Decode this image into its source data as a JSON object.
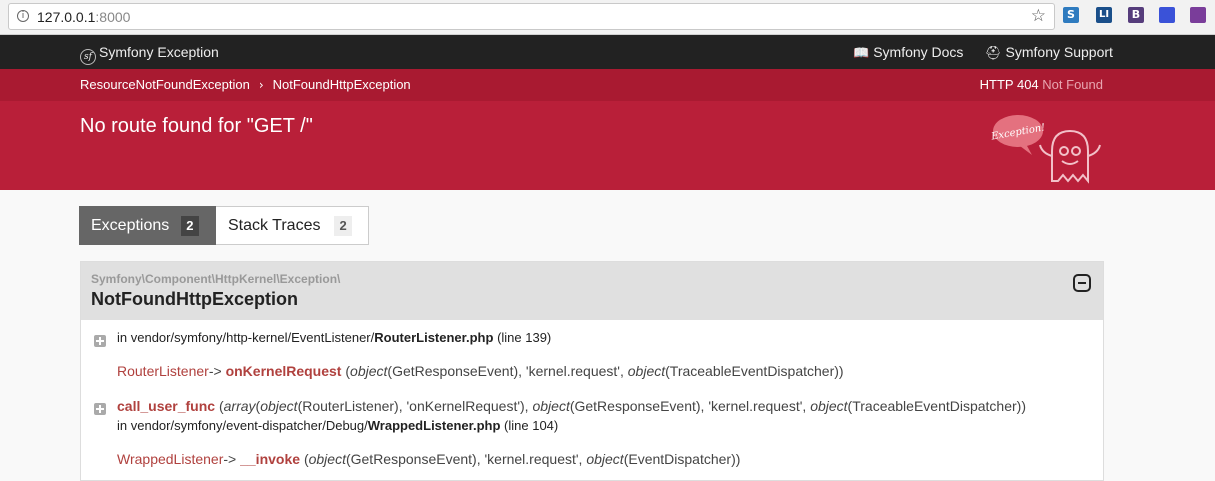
{
  "browser": {
    "url_host": "127.0.0.1",
    "url_port": ":8000",
    "info_glyph": "i",
    "star_glyph": "☆",
    "extensions": [
      {
        "name": "stackedit-extension-icon",
        "glyph": "S",
        "color": "#2f7bbf"
      },
      {
        "name": "linkedin-extension-icon",
        "glyph": "LI",
        "color": "#1a4f8a"
      },
      {
        "name": "bootstrap-extension-icon",
        "glyph": "B",
        "color": "#563d7c"
      },
      {
        "name": "window-extension-icon",
        "glyph": "",
        "color": "#3a52d8"
      },
      {
        "name": "bookmark-extension-icon",
        "glyph": "",
        "color": "#7a3d9a"
      }
    ]
  },
  "topbar": {
    "brand": "Symfony Exception",
    "docs": "Symfony Docs",
    "support": "Symfony Support"
  },
  "breadcrumb": {
    "items": [
      "ResourceNotFoundException",
      "NotFoundHttpException"
    ],
    "separator": "›"
  },
  "status": {
    "code": "HTTP 404",
    "text": "Not Found"
  },
  "title": "No route found for \"GET /\"",
  "ghost_text": "Exception!",
  "tabs": [
    {
      "label": "Exceptions",
      "count": "2"
    },
    {
      "label": "Stack Traces",
      "count": "2"
    }
  ],
  "exception": {
    "namespace": "Symfony\\Component\\HttpKernel\\Exception\\",
    "class": "NotFoundHttpException"
  },
  "trace": {
    "line1": {
      "prefix": "in vendor/symfony/http-kernel/EventListener/",
      "file": "RouterListener.php",
      "suffix": "(line 139)"
    },
    "call1": {
      "cls": "RouterListener",
      "arrow": "->",
      "method": "onKernelRequest",
      "a1": "object",
      "a1v": "(GetResponseEvent), 'kernel.request',",
      "a2": "object",
      "a2v": "(TraceableEventDispatcher))"
    },
    "call2": {
      "fn": "call_user_func",
      "a1": "array",
      "a1v": "(",
      "a2": "object",
      "a2v": "(RouterListener), 'onKernelRequest'),",
      "a3": "object",
      "a3v": "(GetResponseEvent), 'kernel.request',",
      "a4": "object",
      "a4v": "(TraceableEventDispatcher))"
    },
    "line2": {
      "prefix": "in vendor/symfony/event-dispatcher/Debug/",
      "file": "WrappedListener.php",
      "suffix": "(line 104)"
    },
    "call3": {
      "cls": "WrappedListener",
      "arrow": "->",
      "method": "__invoke",
      "a1": "object",
      "a1v": "(GetResponseEvent), 'kernel.request',",
      "a2": "object",
      "a2v": "(EventDispatcher))"
    }
  }
}
